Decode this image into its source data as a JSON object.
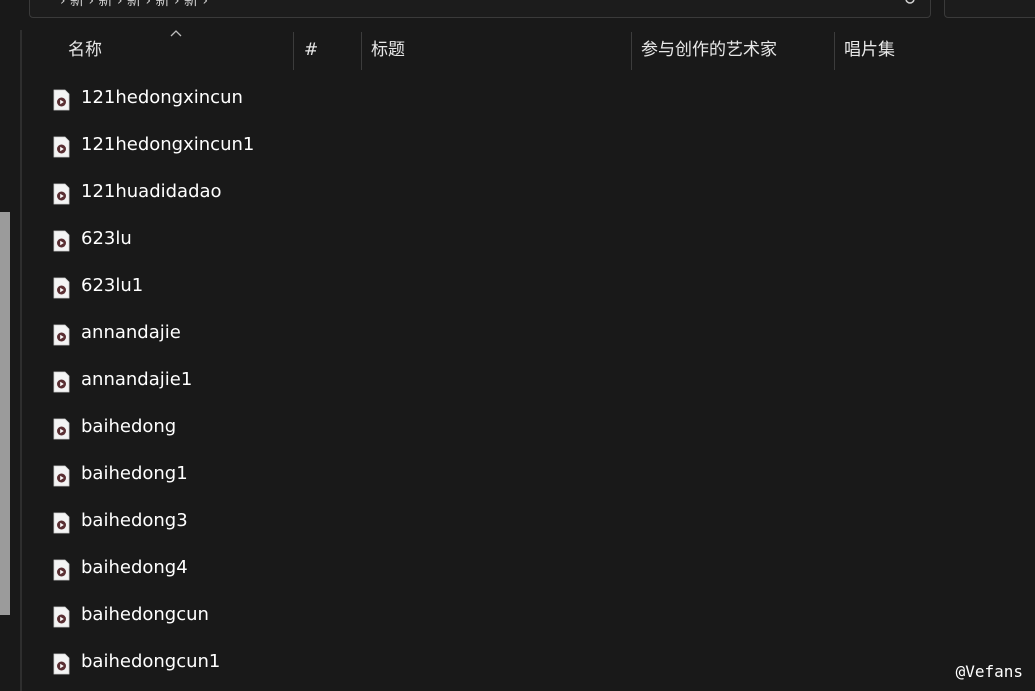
{
  "address_bar": {
    "crumbs": "› 新 › 新 › 新 › 新 › 新 ›"
  },
  "columns": {
    "name": "名称",
    "number": "#",
    "title": "标题",
    "contributing_artists": "参与创作的艺术家",
    "album": "唱片集"
  },
  "files": [
    {
      "name": "121hedongxincun",
      "icon": "video-file-icon"
    },
    {
      "name": "121hedongxincun1",
      "icon": "video-file-icon"
    },
    {
      "name": "121huadidadao",
      "icon": "video-file-icon"
    },
    {
      "name": "623lu",
      "icon": "video-file-icon"
    },
    {
      "name": "623lu1",
      "icon": "video-file-icon"
    },
    {
      "name": "annandajie",
      "icon": "video-file-icon"
    },
    {
      "name": "annandajie1",
      "icon": "video-file-icon"
    },
    {
      "name": "baihedong",
      "icon": "video-file-icon"
    },
    {
      "name": "baihedong1",
      "icon": "video-file-icon"
    },
    {
      "name": "baihedong3",
      "icon": "video-file-icon"
    },
    {
      "name": "baihedong4",
      "icon": "video-file-icon"
    },
    {
      "name": "baihedongcun",
      "icon": "video-file-icon"
    },
    {
      "name": "baihedongcun1",
      "icon": "video-file-icon"
    }
  ],
  "watermark": "@Vefans",
  "colors": {
    "background": "#191919",
    "text": "#ffffff",
    "icon_play": "#7a3a3a"
  }
}
